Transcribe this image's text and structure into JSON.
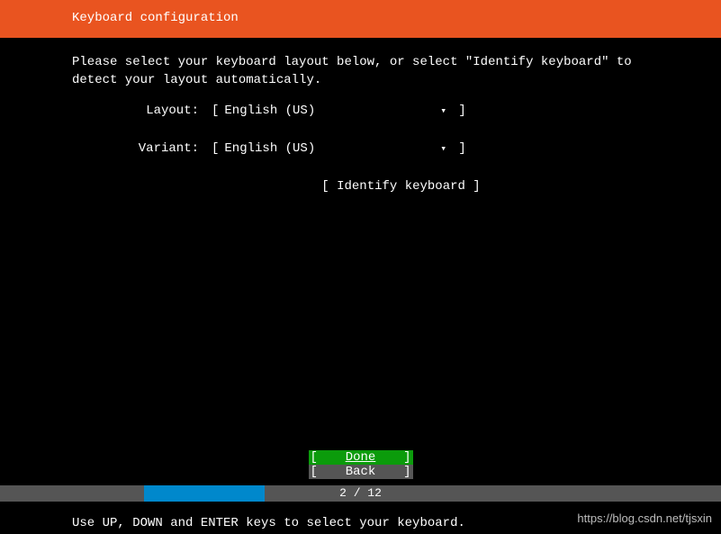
{
  "header": {
    "title": "Keyboard configuration"
  },
  "instruction": "Please select your keyboard layout below, or select \"Identify keyboard\" to detect your layout automatically.",
  "form": {
    "layout": {
      "label": "Layout:",
      "value": "English (US)",
      "arrow": "▾"
    },
    "variant": {
      "label": "Variant:",
      "value": "English (US)",
      "arrow": "▾"
    }
  },
  "identify": {
    "label": "[ Identify keyboard ]"
  },
  "buttons": {
    "done": "Done",
    "back": "Back"
  },
  "progress": {
    "current": 2,
    "total": 12,
    "text": "2 / 12",
    "percent": 16.67
  },
  "footer": {
    "help": "Use UP, DOWN and ENTER keys to select your keyboard."
  },
  "watermark": "https://blog.csdn.net/tjsxin"
}
